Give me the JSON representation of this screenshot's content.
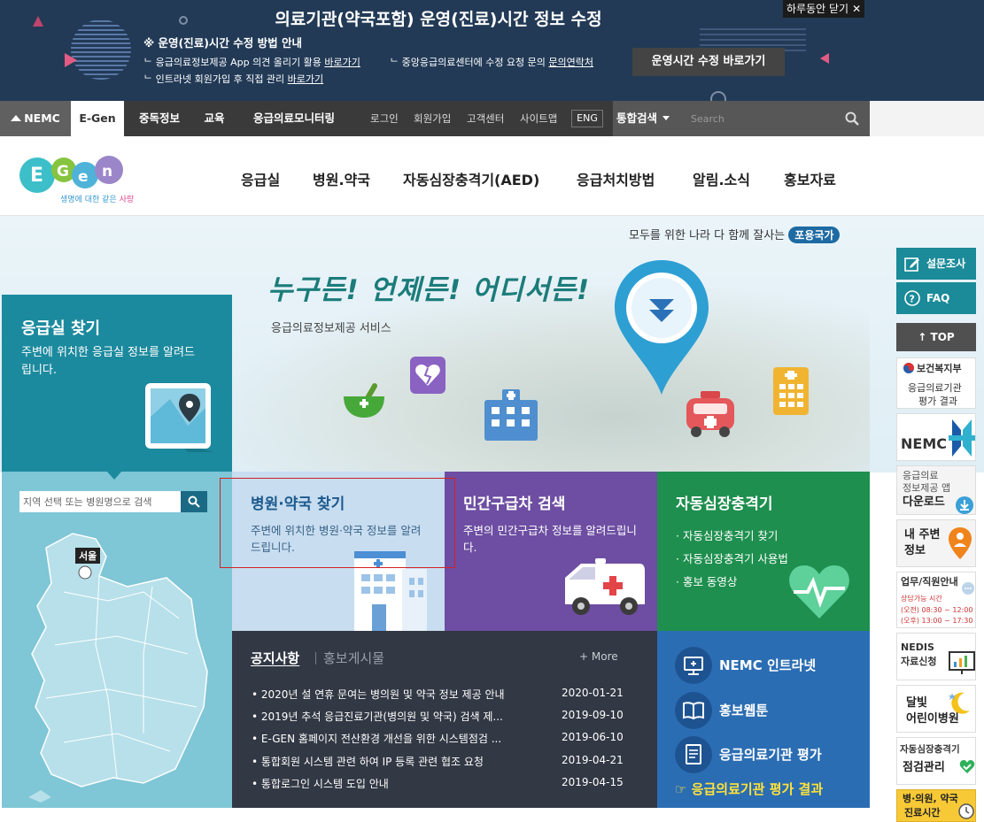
{
  "notice": {
    "title": "의료기관(약국포함) 운영(진료)시간 정보 수정",
    "subtitle": "※ 운영(진료)시간 수정 방법 안내",
    "lines": [
      {
        "text": "응급의료정보제공 App 의견 올리기 활용 ",
        "link": "바로가기"
      },
      {
        "text": "인트라넷 회원가입 후 직접 관리 ",
        "link": "바로가기"
      },
      {
        "text": "중앙응급의료센터에 수정 요청 문의 ",
        "link": "문의연락처"
      }
    ],
    "close_label": "하루동안 닫기",
    "close_icon": "close-icon",
    "button_label": "운영시간 수정 바로가기"
  },
  "util": {
    "tabs": [
      "NEMC",
      "E-Gen",
      "중독정보",
      "교육",
      "응급의료모니터링"
    ],
    "links": [
      "로그인",
      "회원가입",
      "고객센터",
      "사이트맵"
    ],
    "eng": "ENG",
    "unified_search": "통합검색",
    "search_placeholder": "Search"
  },
  "logo": {
    "text": "E-Gen",
    "tagline_prefix": "생명에 대한 같은",
    "tagline_highlight": "사랑"
  },
  "nav": [
    "응급실",
    "병원.약국",
    "자동심장충격기(AED)",
    "응급처치방법",
    "알림.소식",
    "홍보자료"
  ],
  "hero": {
    "inclusive_text": "모두를 위한 나라 다 함께 잘사는",
    "inclusive_badge": "포용국가",
    "slogan": "누구든! 언제든! 어디서든!",
    "subtitle": "응급의료정보제공 서비스"
  },
  "er_finder": {
    "title": "응급실 찾기",
    "desc": "주변에 위치한 응급실 정보를 알려드립니다.",
    "search_placeholder": "지역 선택 또는 병원명으로 검색",
    "map_label": "서울"
  },
  "cards": {
    "hospital": {
      "title": "병원·약국 찾기",
      "desc": "주변에 위치한 병원·약국 정보를 알려드립니다."
    },
    "ambulance": {
      "title": "민간구급차 검색",
      "desc": "주변의 민간구급차 정보를 알려드립니다."
    },
    "aed": {
      "title": "자동심장충격기",
      "items": [
        "· 자동심장충격기 찾기",
        "· 자동심장충격기 사용법",
        "· 홍보 동영상"
      ]
    }
  },
  "board": {
    "tab_active": "공지사항",
    "tab_inactive": "홍보게시물",
    "more": "+ More",
    "posts": [
      {
        "title": "• 2020년 설 연휴 문여는 병의원 및 약국 정보 제공 안내",
        "date": "2020-01-21"
      },
      {
        "title": "• 2019년 추석 응급진료기관(병의원 및 약국) 검색 제...",
        "date": "2019-09-10"
      },
      {
        "title": "• E-GEN 홈페이지 전산환경 개선을 위한 시스템점검 ...",
        "date": "2019-06-10"
      },
      {
        "title": "• 통합회원 시스템 관련 하여 IP 등록 관련 협조 요청",
        "date": "2019-04-21"
      },
      {
        "title": "• 통합로그인 시스템 도입 안내",
        "date": "2019-04-15"
      }
    ]
  },
  "shortcuts": {
    "items": [
      "NEMC 인트라넷",
      "홍보웹툰",
      "응급의료기관 평가"
    ],
    "eval_result": "☞ 응급의료기관 평가 결과"
  },
  "quickbar": {
    "survey": "설문조사",
    "faq": "FAQ",
    "top": "↑ TOP",
    "mohw_name": "보건복지부",
    "mohw_line1": "응급의료기관",
    "mohw_line2": "평가 결과",
    "nemc": "NEMC",
    "app_line1": "응급의료",
    "app_line2": "정보제공 앱",
    "app_line3": "다운로드",
    "near_line1": "내 주변",
    "near_line2": "정보",
    "hours_title": "업무/직원안내",
    "hours_l1": "상담가능 시간",
    "hours_l2": "(오전) 08:30 ~ 12:00",
    "hours_l3": "(오후) 13:00 ~ 17:30",
    "nedis_line1": "NEDIS",
    "nedis_line2": "자료신청",
    "moon_line1": "달빛",
    "moon_line2": "어린이병원",
    "aed_check_line1": "자동심장충격기",
    "aed_check_line2": "점검관리",
    "hosp_hours_line1": "병·의원, 약국",
    "hosp_hours_line2": "진료시간"
  },
  "colors": {
    "notice_bg": "#223a56",
    "teal": "#1c8a9e",
    "purple": "#6d4ea2",
    "green": "#1e8f4e",
    "navy_board": "#323844",
    "blue_panel": "#2b6db3"
  }
}
